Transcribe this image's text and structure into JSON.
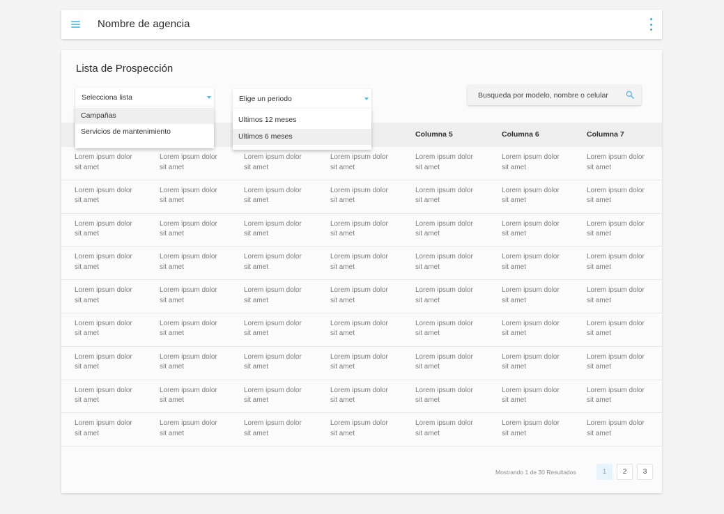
{
  "header": {
    "title": "Nombre de agencia",
    "menu_icon": "hamburger-icon",
    "more_icon": "kebab-icon"
  },
  "page": {
    "title": "Lista de Prospección"
  },
  "filters": {
    "list_select": {
      "label": "Selecciona lista",
      "options": [
        "Campañas",
        "Servicios de mantenimiento"
      ],
      "highlighted": "Campañas"
    },
    "period_select": {
      "label": "Elige un periodo",
      "options": [
        "Ultimos 12 meses",
        "Ultimos 6 meses"
      ],
      "highlighted": "Ultimos 6 meses"
    }
  },
  "search": {
    "placeholder": "Busqueda por modelo, nombre o celular",
    "icon": "search-icon"
  },
  "table": {
    "visible_headers": [
      "Columna 5",
      "Columna 6",
      "Columna 7"
    ],
    "cell_line1": "Lorem ipsum dolor",
    "cell_line2": "sit amet"
  },
  "pagination": {
    "summary": "Mostrando 1 de 30 Resultados",
    "pages": [
      "1",
      "2",
      "3"
    ],
    "current_page": "1"
  },
  "colors": {
    "accent": "#39a9db",
    "accent_light": "#6ec3e6",
    "page_active_bg": "#e7f4fb",
    "header_row_bg": "#eeeeee"
  }
}
